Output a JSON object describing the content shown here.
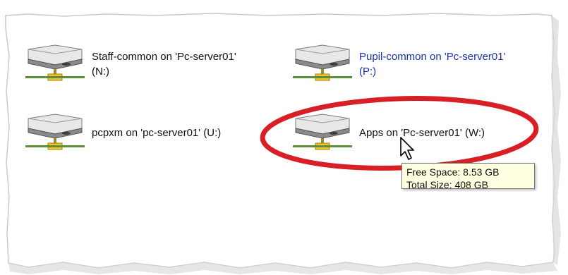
{
  "drives": [
    {
      "name": "Staff-common on 'Pc-server01'",
      "letter": "(N:)",
      "icon": "network-drive-icon"
    },
    {
      "name": "Pupil-common on 'Pc-server01'",
      "letter": "(P:)",
      "icon": "network-drive-icon"
    },
    {
      "name": "pcpxm on 'pc-server01' (U:)",
      "icon": "network-drive-icon"
    },
    {
      "name": "Apps on 'Pc-server01' (W:)",
      "icon": "network-drive-icon"
    }
  ],
  "tooltip": {
    "free_space": "Free Space: 8.53 GB",
    "total_size": "Total Size: 408 GB"
  },
  "colors": {
    "highlight_ellipse": "#d81f26",
    "selected_text": "#1b2fb0",
    "tooltip_bg": "#ffffe1"
  }
}
